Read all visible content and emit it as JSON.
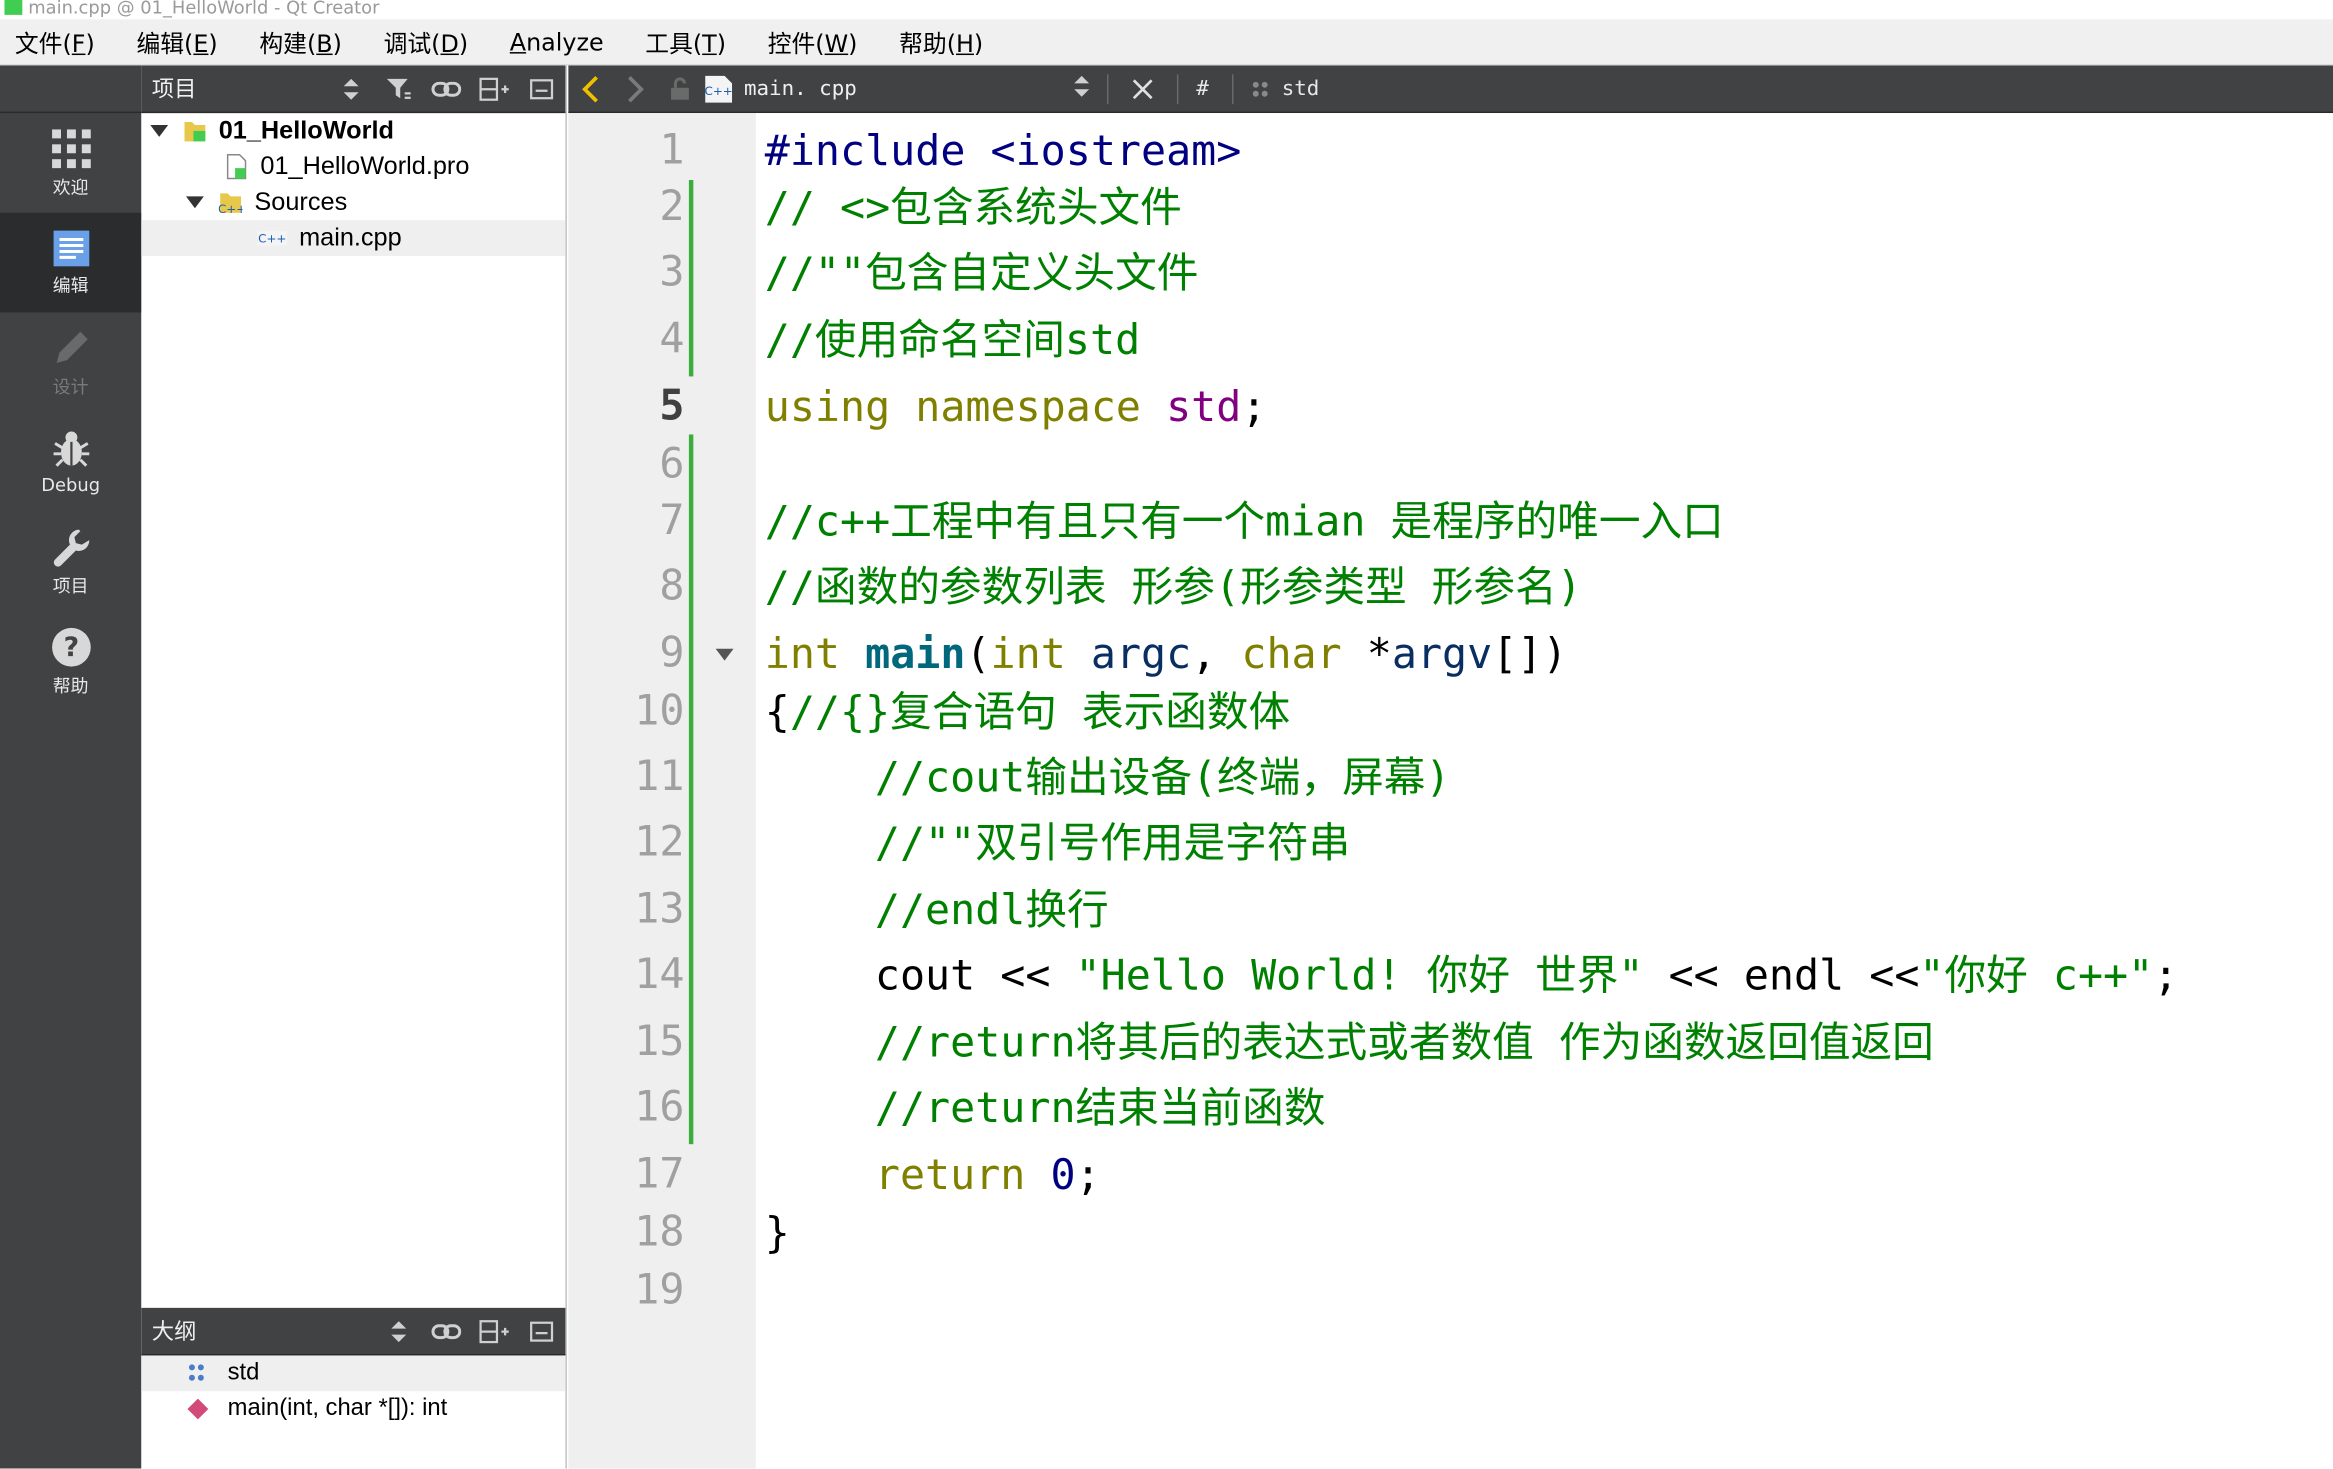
{
  "window": {
    "title": "main.cpp @ 01_HelloWorld - Qt Creator"
  },
  "menu": [
    {
      "label": "文件(",
      "key": "F",
      "tail": ")"
    },
    {
      "label": "编辑(",
      "key": "E",
      "tail": ")"
    },
    {
      "label": "构建(",
      "key": "B",
      "tail": ")"
    },
    {
      "label": "调试(",
      "key": "D",
      "tail": ")"
    },
    {
      "label": "",
      "key": "A",
      "tail": "nalyze"
    },
    {
      "label": "工具(",
      "key": "T",
      "tail": ")"
    },
    {
      "label": "控件(",
      "key": "W",
      "tail": ")"
    },
    {
      "label": "帮助(",
      "key": "H",
      "tail": ")"
    }
  ],
  "modes": [
    {
      "label": "欢迎",
      "icon": "grid-icon",
      "state": "normal"
    },
    {
      "label": "编辑",
      "icon": "document-icon",
      "state": "active"
    },
    {
      "label": "设计",
      "icon": "pencil-icon",
      "state": "disabled"
    },
    {
      "label": "Debug",
      "icon": "bug-icon",
      "state": "normal"
    },
    {
      "label": "项目",
      "icon": "wrench-icon",
      "state": "normal"
    },
    {
      "label": "帮助",
      "icon": "help-icon",
      "state": "normal"
    }
  ],
  "project_pane": {
    "title": "项目",
    "tree": [
      {
        "label": "01_HelloWorld",
        "depth": 0,
        "expanded": true,
        "bold": true,
        "icon": "qt-project-icon"
      },
      {
        "label": "01_HelloWorld.pro",
        "depth": 1,
        "icon": "pro-file-icon"
      },
      {
        "label": "Sources",
        "depth": 1,
        "expanded": true,
        "icon": "sources-folder-icon"
      },
      {
        "label": "main.cpp",
        "depth": 2,
        "selected": true,
        "icon": "cpp-file-icon"
      }
    ]
  },
  "outline_pane": {
    "title": "大纲",
    "items": [
      {
        "label": "std",
        "icon": "namespace-icon",
        "selected": true
      },
      {
        "label": "main(int, char *[]): int",
        "icon": "function-icon"
      }
    ]
  },
  "editor": {
    "file_name": "main. cpp",
    "symbol_hash": "#",
    "symbol": "std",
    "current_line": 5,
    "line_numbers": [
      "1",
      "2",
      "3",
      "4",
      "5",
      "6",
      "7",
      "8",
      "9",
      "10",
      "11",
      "12",
      "13",
      "14",
      "15",
      "16",
      "17",
      "18",
      "19"
    ],
    "code": {
      "l1_inc": "#include <iostream>",
      "l2": "// <>包含系统头文件",
      "l3": "//\"\"包含自定义头文件",
      "l4": "//使用命名空间std",
      "l5_kw": "using namespace",
      "l5_ns": "std",
      "l5_end": ";",
      "l7": "//c++工程中有且只有一个mian 是程序的唯一入口",
      "l8": "//函数的参数列表 形参(形参类型 形参名)",
      "l9_int": "int",
      "l9_main": "main",
      "l9_p1": "(",
      "l9_int2": "int",
      "l9_argc": "argc",
      "l9_comma": ",",
      "l9_char": "char",
      "l9_star": "*",
      "l9_argv": "argv",
      "l9_end": "[])",
      "l10_brace": "{",
      "l10_cmt": "//{}复合语句 表示函数体",
      "l11": "//cout输出设备(终端，屏幕)",
      "l12": "//\"\"双引号作用是字符串",
      "l13": "//endl换行",
      "l14_a": "cout << ",
      "l14_s1": "\"Hello World! 你好 世界\"",
      "l14_b": " << endl <<",
      "l14_s2": "\"你好 c++\"",
      "l14_c": ";",
      "l15": "//return将其后的表达式或者数值 作为函数返回值返回",
      "l16": "//return结束当前函数",
      "l17_kw": "return",
      "l17_num": "0",
      "l17_end": ";",
      "l18": "}"
    }
  }
}
